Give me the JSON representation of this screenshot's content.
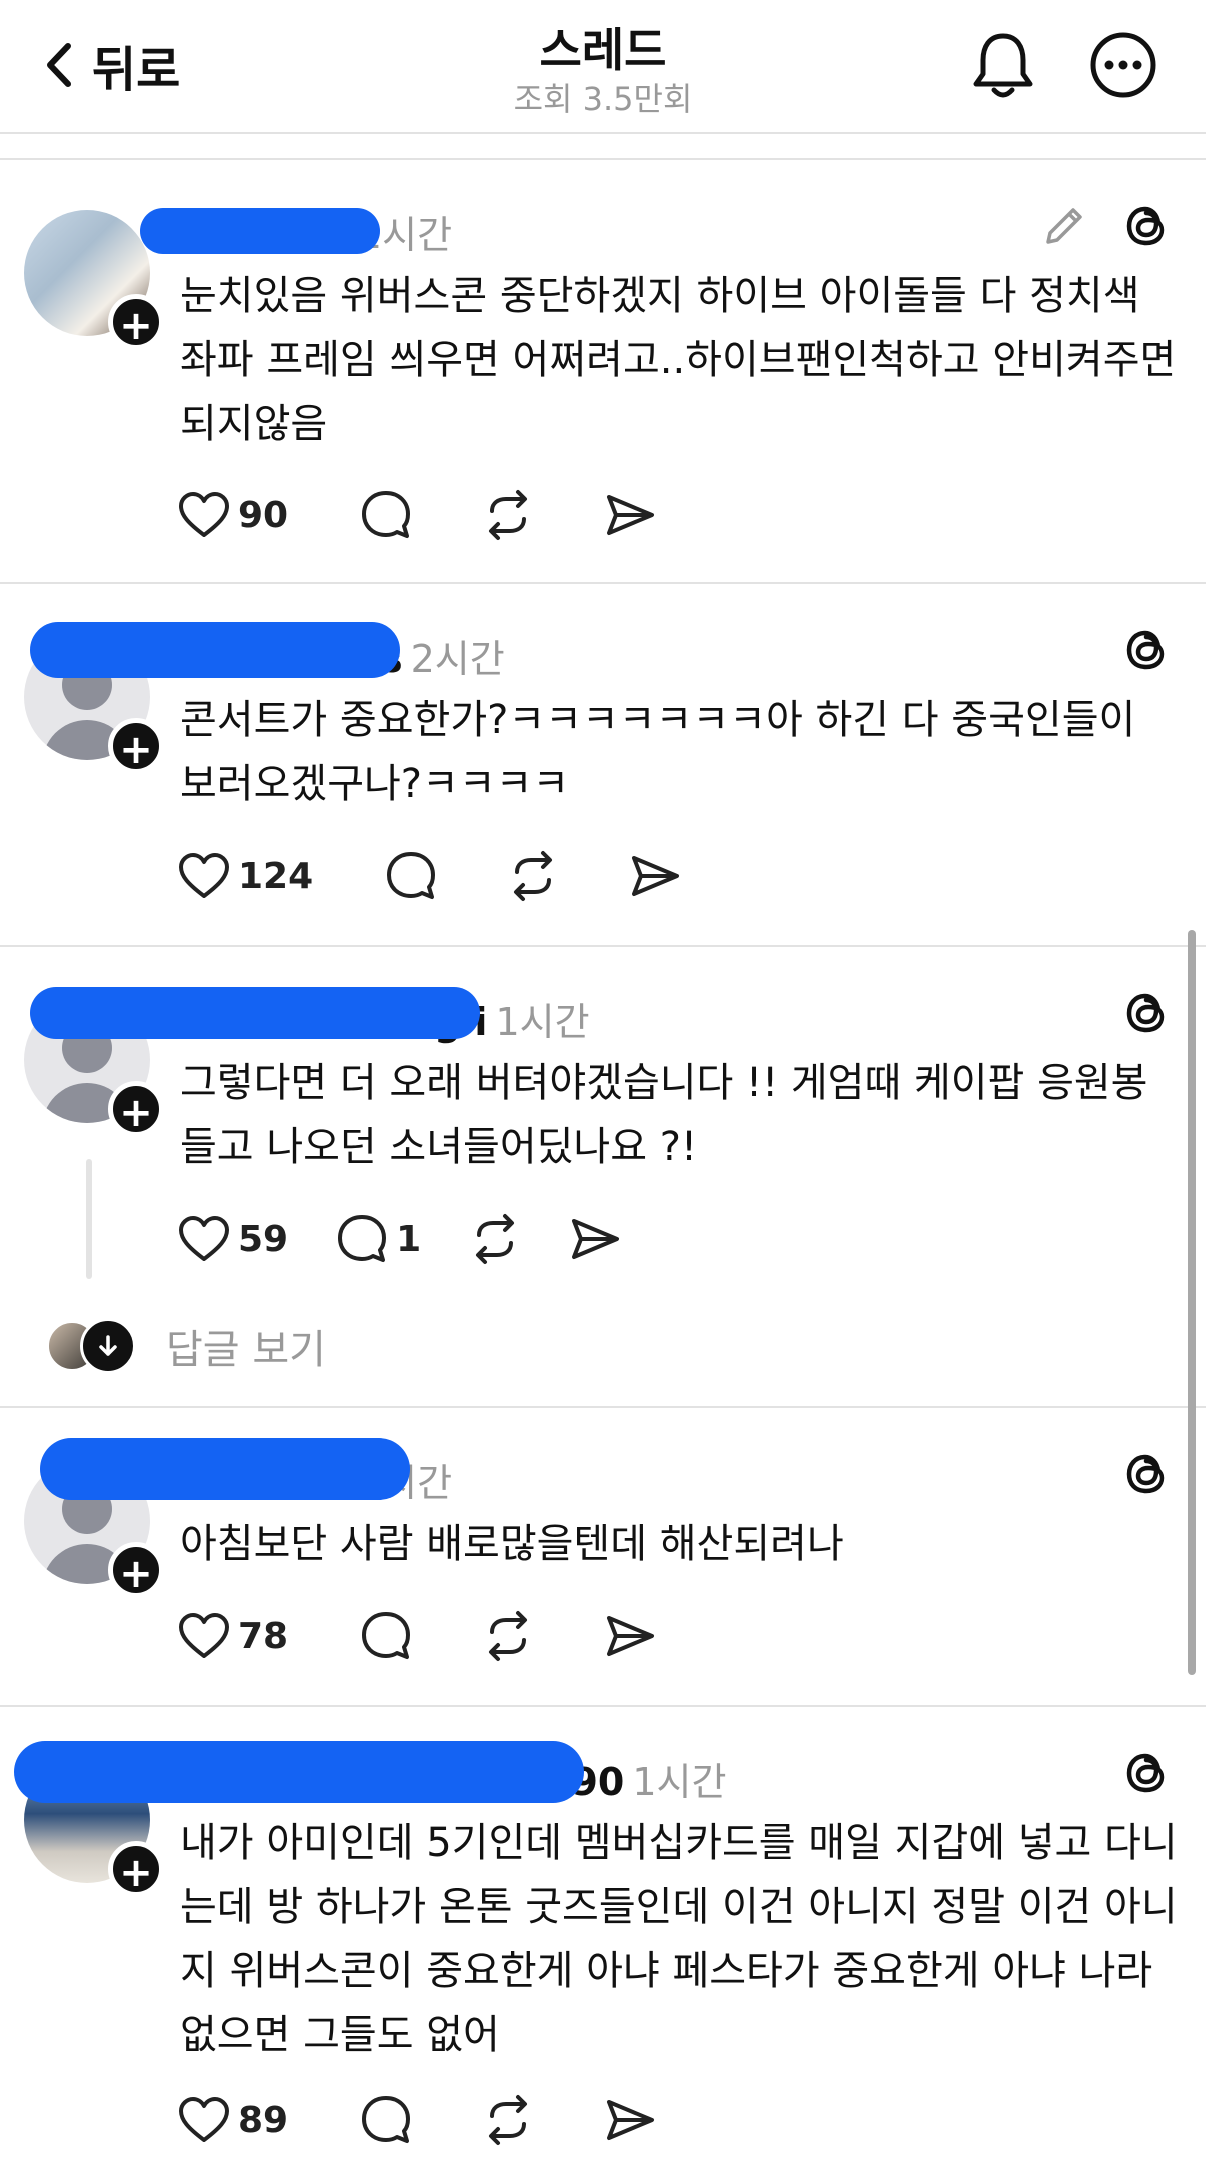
{
  "header": {
    "back_label": "뒤로",
    "title": "스레드",
    "views": "조회 3.5만회"
  },
  "posts": [
    {
      "username": "",
      "time": "2시간",
      "text": "눈치있음 위버스콘 중단하겠지 하이브 아이돌들 다 정치색 좌파 프레임 씌우면 어쩌려고..하이브팬인척하고 안비켜주면 되지않음",
      "likes": "90",
      "comments": "",
      "avatar": "photo"
    },
    {
      "username": "s",
      "time": "2시간",
      "text": "콘서트가 중요한가?ㅋㅋㅋㅋㅋㅋㅋ아 하긴 다 중국인들이 보러오겠구나?ㅋㅋㅋㅋ",
      "likes": "124",
      "comments": "",
      "avatar": "default"
    },
    {
      "username": "g i",
      "time": "1시간",
      "text": "그렇다면 더 오래 버텨야겠습니다 !! 게엄때 케이팝 응원봉들고 나오던 소녀들어딨나요 ?!",
      "likes": "59",
      "comments": "1",
      "avatar": "default",
      "more_replies_label": "답글 보기"
    },
    {
      "username": "",
      "time": "2시간",
      "text": "아침보단 사람 배로많을텐데 해산되려나",
      "likes": "78",
      "comments": "",
      "avatar": "default"
    },
    {
      "username": "390",
      "time": "1시간",
      "text": "내가 아미인데 5기인데 멤버십카드를 매일 지갑에 넣고 다니는데 방 하나가 온톤 굿즈들인데 이건 아니지 정말 이건 아니지 위버스콘이 중요한게 아냐 페스타가 중요한게 아냐 나라없으면 그들도 없어",
      "likes": "89",
      "comments": "",
      "avatar": "photo"
    }
  ],
  "icons": [
    "chevron-left-icon",
    "bell-icon",
    "more-icon",
    "threads-icon",
    "pencil-icon",
    "heart-icon",
    "comment-icon",
    "repost-icon",
    "share-icon"
  ]
}
